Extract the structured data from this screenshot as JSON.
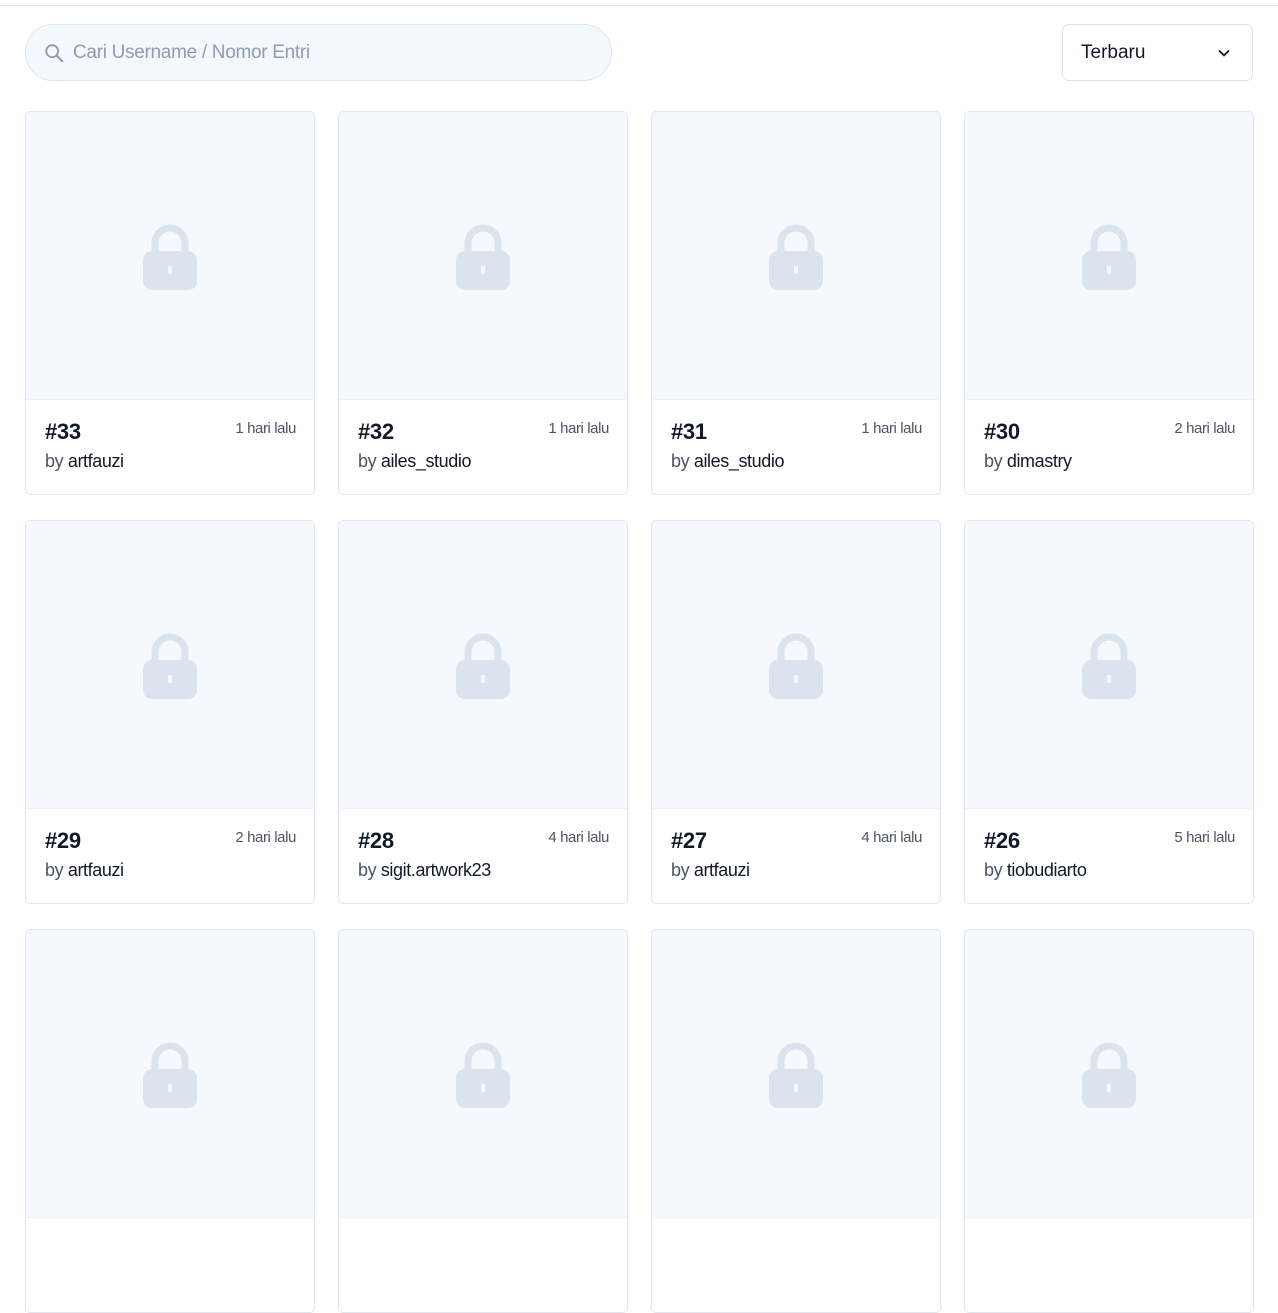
{
  "search": {
    "placeholder": "Cari Username / Nomor Entri",
    "value": ""
  },
  "sort": {
    "selected": "Terbaru"
  },
  "colors": {
    "lock": "#dbe3ee",
    "thumb_bg": "#f5f9fd",
    "accent_text": "#111827"
  },
  "entries": [
    {
      "number": "#33",
      "time": "1 hari lalu",
      "by": "by",
      "user": "artfauzi"
    },
    {
      "number": "#32",
      "time": "1 hari lalu",
      "by": "by",
      "user": "ailes_studio"
    },
    {
      "number": "#31",
      "time": "1 hari lalu",
      "by": "by",
      "user": "ailes_studio"
    },
    {
      "number": "#30",
      "time": "2 hari lalu",
      "by": "by",
      "user": "dimastry"
    },
    {
      "number": "#29",
      "time": "2 hari lalu",
      "by": "by",
      "user": "artfauzi"
    },
    {
      "number": "#28",
      "time": "4 hari lalu",
      "by": "by",
      "user": "sigit.artwork23"
    },
    {
      "number": "#27",
      "time": "4 hari lalu",
      "by": "by",
      "user": "artfauzi"
    },
    {
      "number": "#26",
      "time": "5 hari lalu",
      "by": "by",
      "user": "tiobudiarto"
    },
    {
      "number": "",
      "time": "",
      "by": "",
      "user": ""
    },
    {
      "number": "",
      "time": "",
      "by": "",
      "user": ""
    },
    {
      "number": "",
      "time": "",
      "by": "",
      "user": ""
    },
    {
      "number": "",
      "time": "",
      "by": "",
      "user": ""
    }
  ]
}
